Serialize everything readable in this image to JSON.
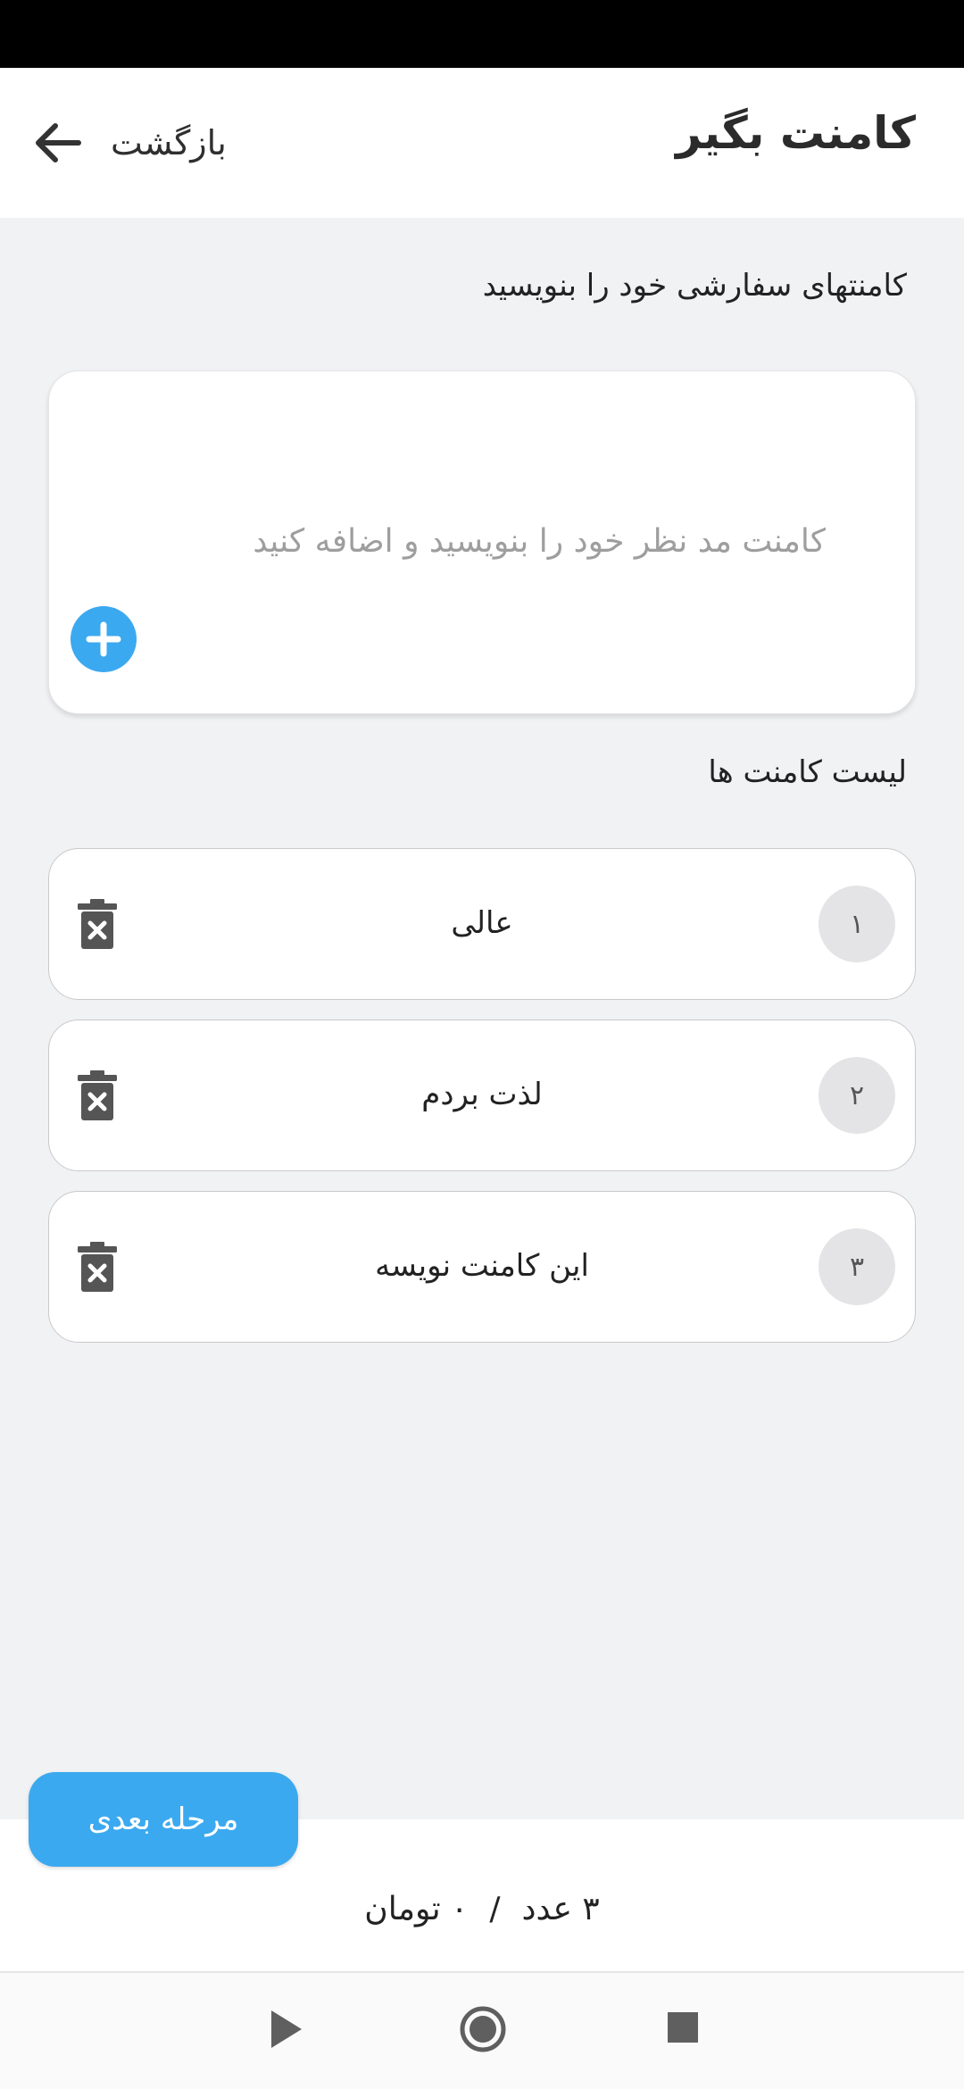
{
  "app_bar": {
    "title": "کامنت بگیر",
    "back_label": "بازگشت"
  },
  "form": {
    "section_label": "کامنتهای سفارشی خود را بنویسید",
    "input_value": "",
    "input_placeholder": "کامنت مد نظر خود را بنویسید و اضافه کنید"
  },
  "list": {
    "section_label": "لیست کامنت ها",
    "items": [
      {
        "number": "۱",
        "text": "عالی"
      },
      {
        "number": "۲",
        "text": "لذت بردم"
      },
      {
        "number": "۳",
        "text": "این کامنت نویسه"
      }
    ]
  },
  "footer": {
    "next_label": "مرحله بعدی",
    "count": "۳ عدد",
    "separator": "/",
    "price": "۰ تومان"
  },
  "colors": {
    "accent": "#3ba9ef",
    "background": "#f1f2f4",
    "delete_icon": "#555555"
  },
  "icons": {
    "back": "arrow-left-icon",
    "add": "plus-icon",
    "delete": "trash-x-icon",
    "nav_back": "triangle-play-icon",
    "nav_home": "circle-home-icon",
    "nav_recents": "square-recents-icon"
  }
}
